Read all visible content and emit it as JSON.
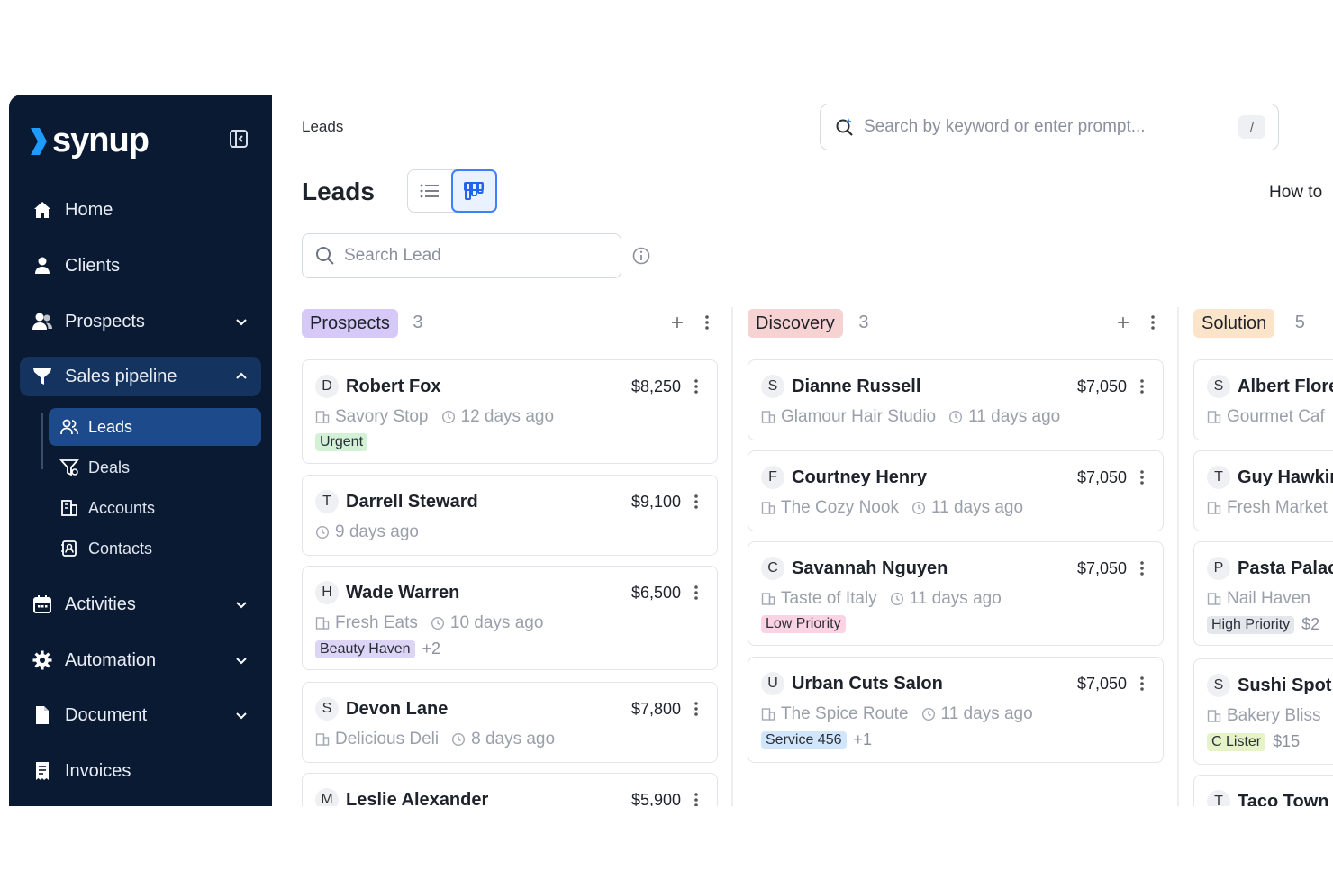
{
  "brand": {
    "name": "synup",
    "accent": "#1e9bff"
  },
  "sidebar": {
    "items": [
      {
        "label": "Home",
        "icon": "home-icon"
      },
      {
        "label": "Clients",
        "icon": "user-icon"
      },
      {
        "label": "Prospects",
        "icon": "users-icon"
      },
      {
        "label": "Sales pipeline",
        "icon": "funnel-icon"
      },
      {
        "label": "Activities",
        "icon": "calendar-icon"
      },
      {
        "label": "Automation",
        "icon": "gear-icon"
      },
      {
        "label": "Document",
        "icon": "document-icon"
      },
      {
        "label": "Invoices",
        "icon": "invoice-icon"
      }
    ],
    "sub_items": [
      {
        "label": "Leads",
        "icon": "users-outline-icon"
      },
      {
        "label": "Deals",
        "icon": "funnel-outline-icon"
      },
      {
        "label": "Accounts",
        "icon": "building-icon"
      },
      {
        "label": "Contacts",
        "icon": "contact-card-icon"
      }
    ]
  },
  "topbar": {
    "breadcrumb": "Leads",
    "search_placeholder": "Search by keyword or enter prompt...",
    "shortcut": "/"
  },
  "header": {
    "title": "Leads",
    "help": "How to"
  },
  "lead_search": {
    "placeholder": "Search Lead"
  },
  "columns": [
    {
      "stage": "Prospects",
      "count": "3",
      "color": "#d6c9f7",
      "cards": [
        {
          "initial": "D",
          "name": "Robert Fox",
          "amount": "$8,250",
          "company": "Savory Stop",
          "time": "12 days ago",
          "tag": "Urgent",
          "tag_color": "#d3f2d5",
          "more": ""
        },
        {
          "initial": "T",
          "name": "Darrell Steward",
          "amount": "$9,100",
          "company": "",
          "time": "9 days ago",
          "tag": "",
          "more": ""
        },
        {
          "initial": "H",
          "name": "Wade Warren",
          "amount": "$6,500",
          "company": "Fresh Eats",
          "time": "10 days ago",
          "tag": "Beauty Haven",
          "tag_color": "#ddd5f5",
          "more": "+2"
        },
        {
          "initial": "S",
          "name": "Devon Lane",
          "amount": "$7,800",
          "company": "Delicious Deli",
          "time": "8 days ago",
          "tag": "",
          "more": ""
        },
        {
          "initial": "M",
          "name": "Leslie Alexander",
          "amount": "$5,900",
          "company": "",
          "time": "",
          "tag": "",
          "more": ""
        }
      ]
    },
    {
      "stage": "Discovery",
      "count": "3",
      "color": "#f7d2d2",
      "cards": [
        {
          "initial": "S",
          "name": "Dianne Russell",
          "amount": "$7,050",
          "company": "Glamour Hair Studio",
          "time": "11 days ago",
          "tag": "",
          "more": ""
        },
        {
          "initial": "F",
          "name": "Courtney Henry",
          "amount": "$7,050",
          "company": "The Cozy Nook",
          "time": "11 days ago",
          "tag": "",
          "more": ""
        },
        {
          "initial": "C",
          "name": "Savannah Nguyen",
          "amount": "$7,050",
          "company": "Taste of Italy",
          "time": "11 days ago",
          "tag": "Low Priority",
          "tag_color": "#fbd3e3",
          "more": ""
        },
        {
          "initial": "U",
          "name": "Urban Cuts Salon",
          "amount": "$7,050",
          "company": "The Spice Route",
          "time": "11 days ago",
          "tag": "Service 456",
          "tag_color": "#d2e6fb",
          "more": "+1"
        }
      ]
    },
    {
      "stage": "Solution",
      "count": "5",
      "color": "#fbe4c9",
      "cards": [
        {
          "initial": "S",
          "name": "Albert Flore",
          "amount": "",
          "company": "Gourmet Caf",
          "time": "",
          "tag": "",
          "more": ""
        },
        {
          "initial": "T",
          "name": "Guy Hawkir",
          "amount": "",
          "company": "Fresh Market",
          "time": "",
          "tag": "",
          "more": ""
        },
        {
          "initial": "P",
          "name": "Pasta Palac",
          "amount": "",
          "company": "Nail Haven",
          "time": "",
          "tag": "High Priority",
          "tag_color": "#e3e6ea",
          "more": "$2"
        },
        {
          "initial": "S",
          "name": "Sushi Spot",
          "amount": "",
          "company": "Bakery Bliss",
          "time": "",
          "tag": "C Lister",
          "tag_color": "#e6f3c9",
          "more": "$15"
        },
        {
          "initial": "T",
          "name": "Taco Town",
          "amount": "",
          "company": "",
          "time": "",
          "tag": "",
          "more": ""
        }
      ]
    }
  ]
}
